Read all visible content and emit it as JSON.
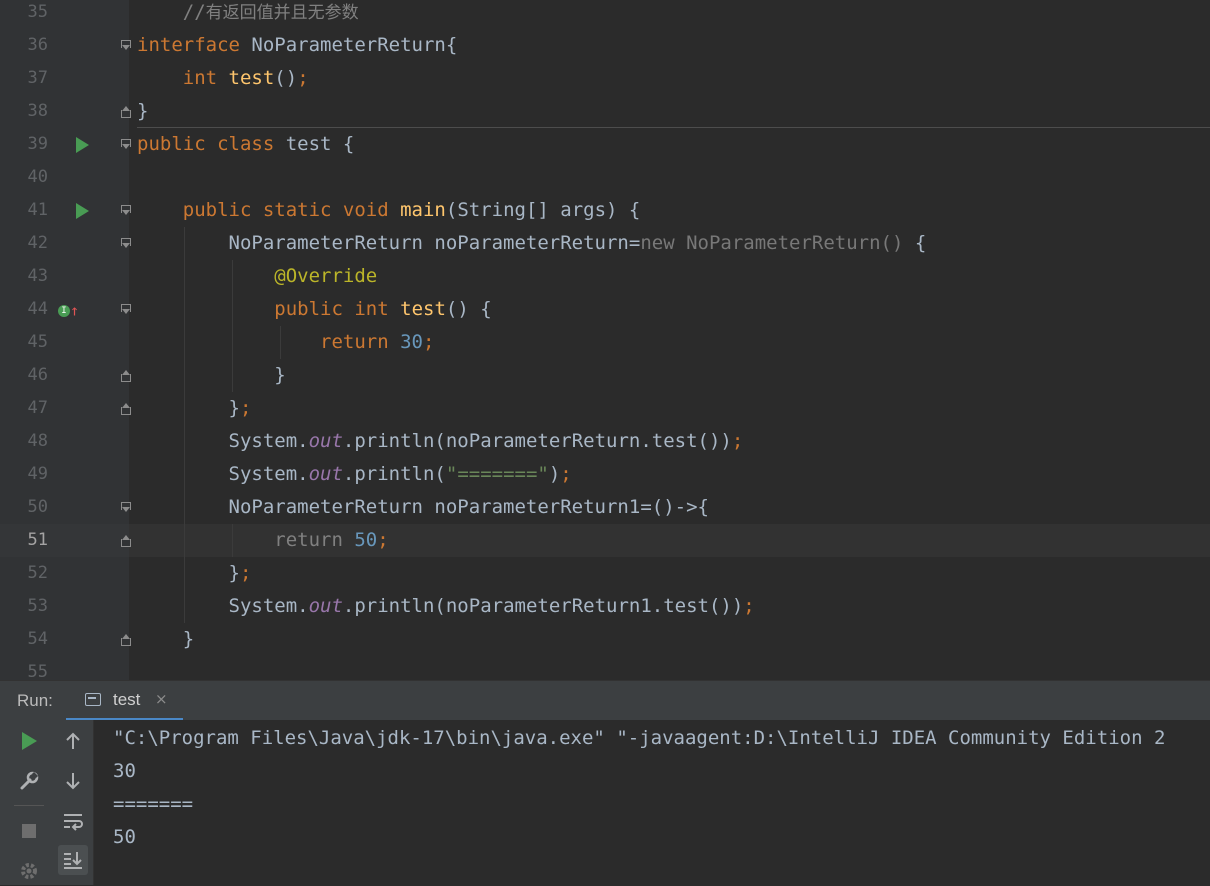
{
  "editor": {
    "lines": [
      {
        "num": "35",
        "spans": [
          {
            "t": "    ",
            "c": ""
          },
          {
            "t": "//",
            "c": "cm"
          },
          {
            "t": "有返回值并且无参数",
            "c": "cm cmt-cjk"
          }
        ]
      },
      {
        "num": "36",
        "spans": [
          {
            "t": "interface ",
            "c": "kw"
          },
          {
            "t": "NoParameterReturn{",
            "c": ""
          }
        ]
      },
      {
        "num": "37",
        "spans": [
          {
            "t": "    ",
            "c": ""
          },
          {
            "t": "int ",
            "c": "kw"
          },
          {
            "t": "test",
            "c": "fn"
          },
          {
            "t": "()",
            "c": ""
          },
          {
            "t": ";",
            "c": "kw"
          }
        ]
      },
      {
        "num": "38",
        "spans": [
          {
            "t": "}",
            "c": ""
          }
        ]
      },
      {
        "num": "39",
        "spans": [
          {
            "t": "public class ",
            "c": "kw"
          },
          {
            "t": "test {",
            "c": ""
          }
        ]
      },
      {
        "num": "40",
        "spans": []
      },
      {
        "num": "41",
        "spans": [
          {
            "t": "    ",
            "c": ""
          },
          {
            "t": "public static void ",
            "c": "kw"
          },
          {
            "t": "main",
            "c": "fn"
          },
          {
            "t": "(String[] args) {",
            "c": ""
          }
        ]
      },
      {
        "num": "42",
        "spans": [
          {
            "t": "        NoParameterReturn noParameterReturn=",
            "c": ""
          },
          {
            "t": "new ",
            "c": "dim"
          },
          {
            "t": "NoParameterReturn() ",
            "c": "dim"
          },
          {
            "t": "{",
            "c": ""
          }
        ]
      },
      {
        "num": "43",
        "spans": [
          {
            "t": "            ",
            "c": ""
          },
          {
            "t": "@Override",
            "c": "an"
          }
        ]
      },
      {
        "num": "44",
        "spans": [
          {
            "t": "            ",
            "c": ""
          },
          {
            "t": "public int ",
            "c": "kw"
          },
          {
            "t": "test",
            "c": "fn"
          },
          {
            "t": "() {",
            "c": ""
          }
        ]
      },
      {
        "num": "45",
        "spans": [
          {
            "t": "                ",
            "c": ""
          },
          {
            "t": "return ",
            "c": "kw"
          },
          {
            "t": "30",
            "c": "num"
          },
          {
            "t": ";",
            "c": "kw"
          }
        ]
      },
      {
        "num": "46",
        "spans": [
          {
            "t": "            }",
            "c": ""
          }
        ]
      },
      {
        "num": "47",
        "spans": [
          {
            "t": "        }",
            "c": ""
          },
          {
            "t": ";",
            "c": "kw"
          }
        ]
      },
      {
        "num": "48",
        "spans": [
          {
            "t": "        System.",
            "c": ""
          },
          {
            "t": "out",
            "c": "fld"
          },
          {
            "t": ".println(noParameterReturn.test())",
            "c": ""
          },
          {
            "t": ";",
            "c": "kw"
          }
        ]
      },
      {
        "num": "49",
        "spans": [
          {
            "t": "        System.",
            "c": ""
          },
          {
            "t": "out",
            "c": "fld"
          },
          {
            "t": ".println(",
            "c": ""
          },
          {
            "t": "\"=======\"",
            "c": "str"
          },
          {
            "t": ")",
            "c": ""
          },
          {
            "t": ";",
            "c": "kw"
          }
        ]
      },
      {
        "num": "50",
        "spans": [
          {
            "t": "        NoParameterReturn noParameterReturn1=()->{",
            "c": ""
          }
        ]
      },
      {
        "num": "51",
        "spans": [
          {
            "t": "            ",
            "c": ""
          },
          {
            "t": "return ",
            "c": "grey"
          },
          {
            "t": "50",
            "c": "num"
          },
          {
            "t": ";",
            "c": "kw"
          }
        ]
      },
      {
        "num": "52",
        "spans": [
          {
            "t": "        }",
            "c": ""
          },
          {
            "t": ";",
            "c": "kw"
          }
        ]
      },
      {
        "num": "53",
        "spans": [
          {
            "t": "        System.",
            "c": ""
          },
          {
            "t": "out",
            "c": "fld"
          },
          {
            "t": ".println(noParameterReturn1.test())",
            "c": ""
          },
          {
            "t": ";",
            "c": "kw"
          }
        ]
      },
      {
        "num": "54",
        "spans": [
          {
            "t": "    }",
            "c": ""
          }
        ]
      },
      {
        "num": "55",
        "spans": []
      }
    ],
    "current_line": "51"
  },
  "run": {
    "label": "Run:",
    "tab_label": "test",
    "tab_close": "×",
    "console": [
      "\"C:\\Program Files\\Java\\jdk-17\\bin\\java.exe\" \"-javaagent:D:\\IntelliJ IDEA Community Edition 2",
      "30",
      "=======",
      "50"
    ],
    "toolbar": {
      "rerun_icon": "play-icon",
      "wrench_icon": "wrench-icon",
      "stop_icon": "stop-icon",
      "settings_icon": "gear-icon",
      "up_icon": "arrow-up-icon",
      "down_icon": "arrow-down-icon",
      "wrap_icon": "soft-wrap-icon",
      "scroll_icon": "scroll-to-end-icon"
    }
  },
  "colors": {
    "background": "#2b2b2b",
    "keyword": "#cc7832",
    "function": "#ffc66d",
    "number": "#6897bb",
    "string": "#6a8759",
    "annotation": "#bbb529",
    "field": "#9876aa"
  }
}
